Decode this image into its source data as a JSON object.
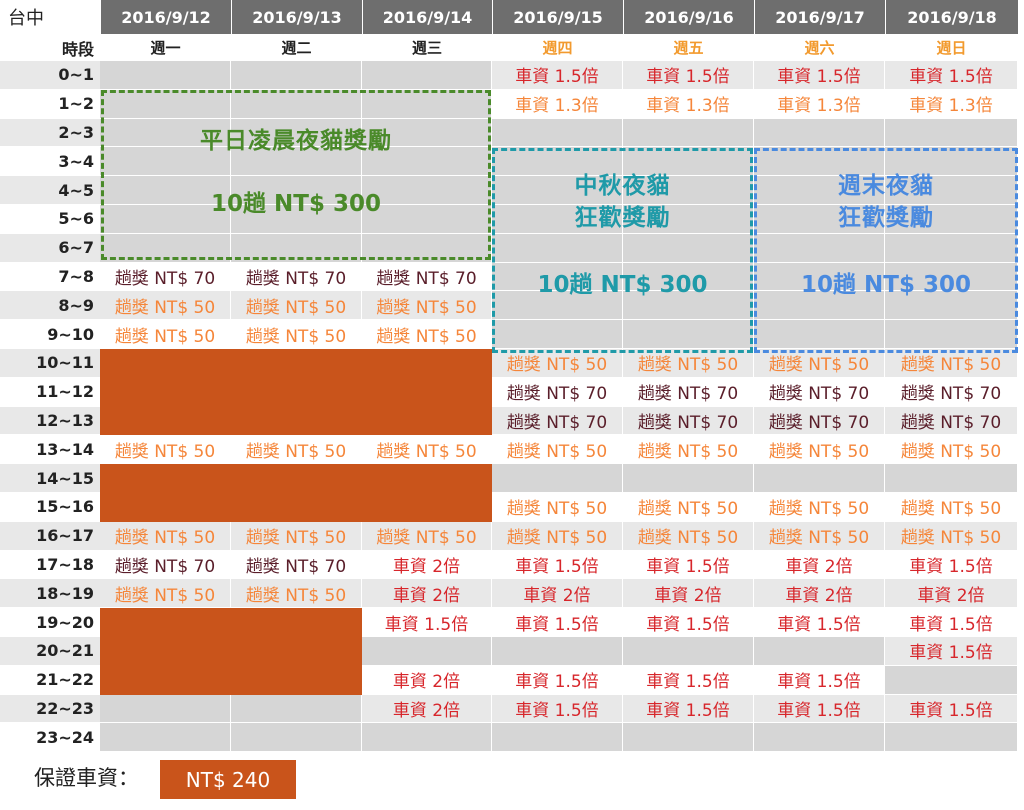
{
  "table": {
    "corner": "台中",
    "period_label": "時段",
    "dates": [
      "2016/9/12",
      "2016/9/13",
      "2016/9/14",
      "2016/9/15",
      "2016/9/16",
      "2016/9/17",
      "2016/9/18"
    ],
    "weekdays": [
      "週一",
      "週二",
      "週三",
      "週四",
      "週五",
      "週六",
      "週日"
    ],
    "time_slots": [
      "0~1",
      "1~2",
      "2~3",
      "3~4",
      "4~5",
      "5~6",
      "6~7",
      "7~8",
      "8~9",
      "9~10",
      "10~11",
      "11~12",
      "12~13",
      "13~14",
      "14~15",
      "15~16",
      "16~17",
      "17~18",
      "18~19",
      "19~20",
      "20~21",
      "21~22",
      "22~23",
      "23~24"
    ],
    "cells": [
      [
        "",
        "",
        "",
        "車資 1.5倍",
        "車資 1.5倍",
        "車資 1.5倍",
        "車資 1.5倍"
      ],
      [
        "",
        "",
        "",
        "車資 1.3倍",
        "車資 1.3倍",
        "車資 1.3倍",
        "車資 1.3倍"
      ],
      [
        "",
        "",
        "",
        "",
        "",
        "",
        ""
      ],
      [
        "",
        "",
        "",
        "",
        "",
        "",
        ""
      ],
      [
        "",
        "",
        "",
        "",
        "",
        "",
        ""
      ],
      [
        "",
        "",
        "",
        "",
        "",
        "",
        ""
      ],
      [
        "",
        "",
        "",
        "",
        "",
        "",
        ""
      ],
      [
        "趟獎 NT$ 70",
        "趟獎 NT$ 70",
        "趟獎 NT$ 70",
        "",
        "",
        "",
        ""
      ],
      [
        "趟獎 NT$ 50",
        "趟獎 NT$ 50",
        "趟獎 NT$ 50",
        "",
        "",
        "",
        ""
      ],
      [
        "趟獎 NT$ 50",
        "趟獎 NT$ 50",
        "趟獎 NT$ 50",
        "",
        "",
        "",
        ""
      ],
      [
        "#",
        "#",
        "#",
        "趟獎 NT$ 50",
        "趟獎 NT$ 50",
        "趟獎 NT$ 50",
        "趟獎 NT$ 50"
      ],
      [
        "#",
        "#",
        "#",
        "趟獎 NT$ 70",
        "趟獎 NT$ 70",
        "趟獎 NT$ 70",
        "趟獎 NT$ 70"
      ],
      [
        "#",
        "#",
        "#",
        "趟獎 NT$ 70",
        "趟獎 NT$ 70",
        "趟獎 NT$ 70",
        "趟獎 NT$ 70"
      ],
      [
        "趟獎 NT$ 50",
        "趟獎 NT$ 50",
        "趟獎 NT$ 50",
        "趟獎 NT$ 50",
        "趟獎 NT$ 50",
        "趟獎 NT$ 50",
        "趟獎 NT$ 50"
      ],
      [
        "#",
        "#",
        "#",
        "",
        "",
        "",
        ""
      ],
      [
        "#",
        "#",
        "#",
        "趟獎 NT$ 50",
        "趟獎 NT$ 50",
        "趟獎 NT$ 50",
        "趟獎 NT$ 50"
      ],
      [
        "趟獎 NT$ 50",
        "趟獎 NT$ 50",
        "趟獎 NT$ 50",
        "趟獎 NT$ 50",
        "趟獎 NT$ 50",
        "趟獎 NT$ 50",
        "趟獎 NT$ 50"
      ],
      [
        "趟獎 NT$ 70",
        "趟獎 NT$ 70",
        "車資 2倍",
        "車資 1.5倍",
        "車資 1.5倍",
        "車資 2倍",
        "車資 1.5倍"
      ],
      [
        "趟獎 NT$ 50",
        "趟獎 NT$ 50",
        "車資 2倍",
        "車資 2倍",
        "車資 2倍",
        "車資 2倍",
        "車資 2倍"
      ],
      [
        "#",
        "#",
        "車資 1.5倍",
        "車資 1.5倍",
        "車資 1.5倍",
        "車資 1.5倍",
        "車資 1.5倍"
      ],
      [
        "#",
        "#",
        "",
        "",
        "",
        "",
        "車資 1.5倍"
      ],
      [
        "#",
        "#",
        "車資 2倍",
        "車資 1.5倍",
        "車資 1.5倍",
        "車資 1.5倍",
        ""
      ],
      [
        "",
        "",
        "車資 2倍",
        "車資 1.5倍",
        "車資 1.5倍",
        "車資 1.5倍",
        "車資 1.5倍"
      ],
      [
        "",
        "",
        "",
        "",
        "",
        "",
        ""
      ]
    ]
  },
  "promotions": {
    "weekday_night": {
      "title": "平日凌晨夜貓獎勵",
      "amount": "10趟 NT$ 300"
    },
    "mid_autumn": {
      "title_line1": "中秋夜貓",
      "title_line2": "狂歡獎勵",
      "amount": "10趟 NT$ 300"
    },
    "weekend_night": {
      "title_line1": "週末夜貓",
      "title_line2": "狂歡獎勵",
      "amount": "10趟 NT$ 300"
    }
  },
  "legend": {
    "label": "保證車資：",
    "value": "NT$ 240"
  },
  "colors": {
    "header_bg": "#6e6e6e",
    "blocked": "#c9541b",
    "weekend_text": "#f29a2e",
    "fare_multiplier_text": "#d7262b",
    "fare_1_3_text": "#f5863a",
    "bonus_70_text": "#5a1e2a",
    "bonus_50_text": "#f5863a",
    "green_promo": "#4a8a2a",
    "teal_promo": "#1f9aa8",
    "blue_promo": "#4a8adf"
  }
}
